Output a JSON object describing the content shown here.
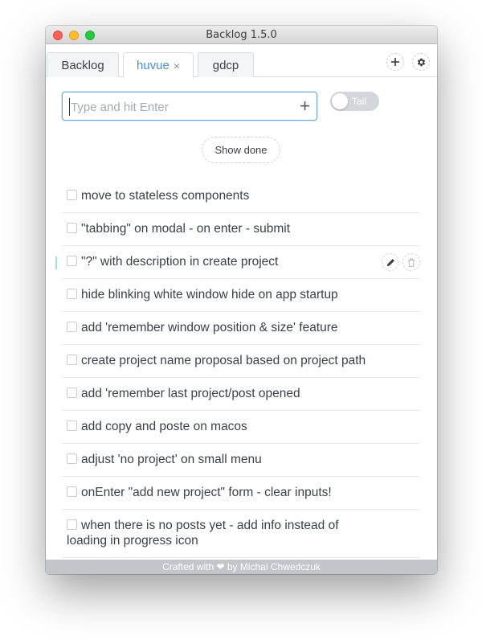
{
  "window": {
    "title": "Backlog 1.5.0"
  },
  "tabs": [
    {
      "label": "Backlog",
      "active": false
    },
    {
      "label": "huvue",
      "active": true,
      "close_glyph": "×"
    },
    {
      "label": "gdcp",
      "active": false
    }
  ],
  "toolbar": {
    "add_icon": "plus-icon",
    "settings_icon": "gear-icon"
  },
  "input": {
    "placeholder": "Type and hit Enter",
    "value": "",
    "add_glyph": "+"
  },
  "tail_toggle": {
    "label": "Tail",
    "on": false
  },
  "show_done": {
    "label": "Show done"
  },
  "todos": [
    {
      "text": "move to stateless components",
      "done": false
    },
    {
      "text": "\"tabbing\" on modal - on enter - submit",
      "done": false
    },
    {
      "text": "\"?\" with description in create project",
      "done": false
    },
    {
      "text": "hide blinking white window hide on app startup",
      "done": false
    },
    {
      "text": "add 'remember window position & size' feature",
      "done": false
    },
    {
      "text": "create project name proposal based on project path",
      "done": false
    },
    {
      "text": "add 'remember last project/post opened",
      "done": false
    },
    {
      "text": "add copy and poste on macos",
      "done": false
    },
    {
      "text": "adjust 'no project' on small menu",
      "done": false
    },
    {
      "text": "onEnter \"add new project\" form - clear inputs!",
      "done": false
    },
    {
      "text": "when there is no posts yet - add info instead of loading in progress icon",
      "done": false
    }
  ],
  "footer": {
    "text": "Crafted with ❤ by Michal Chwedczuk"
  },
  "colors": {
    "accent": "#4a90d9",
    "footer_bg": "#c2c5c9",
    "active_marker": "#a6e3cf"
  }
}
